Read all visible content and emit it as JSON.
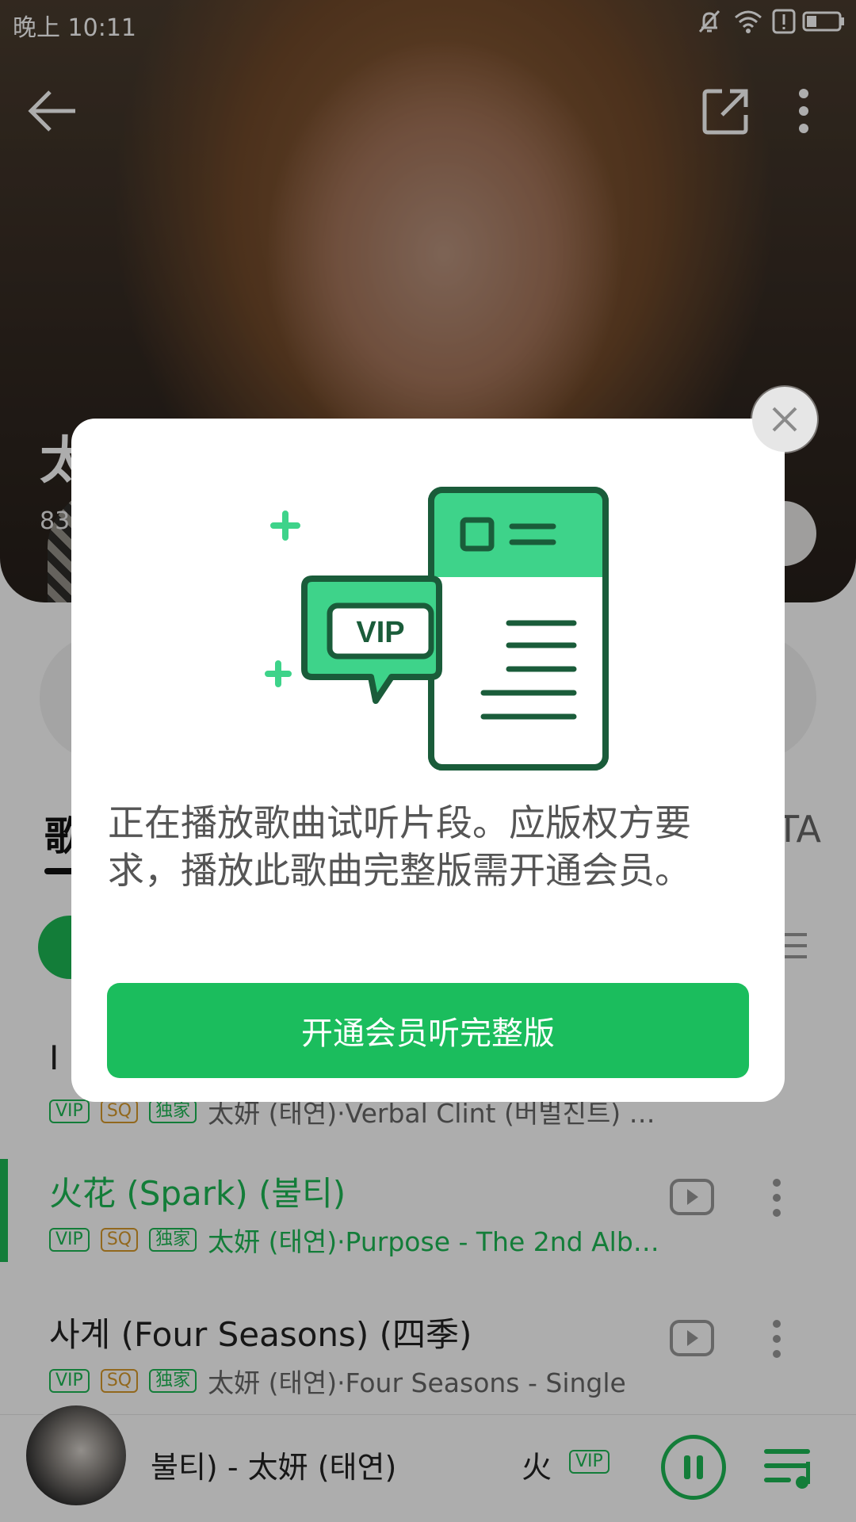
{
  "status_bar": {
    "time": "晚上 10:11",
    "icons": [
      "bell-off-icon",
      "wifi-icon",
      "alert-icon",
      "battery-icon"
    ]
  },
  "top_nav": {
    "back_icon": "back-arrow-icon",
    "share_icon": "share-icon",
    "more_icon": "more-vertical-icon"
  },
  "tabs": {
    "active_label": "歌",
    "right_label": "TA"
  },
  "songs": [
    {
      "title": "I (",
      "tags": [
        "VIP",
        "SQ",
        "独家"
      ],
      "artist": "太妍 (태연)·Verbal Clint (버벌진트) I…",
      "active": false
    },
    {
      "title": "火花 (Spark) (불티)",
      "tags": [
        "VIP",
        "SQ",
        "独家"
      ],
      "artist": "太妍 (태연)·Purpose - The 2nd Alb…",
      "active": true
    },
    {
      "title": "사계 (Four Seasons) (四季)",
      "tags": [
        "VIP",
        "SQ",
        "独家"
      ],
      "artist": "太妍 (태연)·Four Seasons - Single",
      "active": false
    }
  ],
  "mini_player": {
    "now_playing": "불티) - 太妍 (태연)",
    "scroll_text": "火",
    "badge": "VIP"
  },
  "dialog": {
    "illustration_badge": "VIP",
    "message": "正在播放歌曲试听片段。应版权方要求，播放此歌曲完整版需开通会员。",
    "cta_label": "开通会员听完整版",
    "close_icon": "close-icon"
  },
  "colors": {
    "brand_green": "#1bbd5d",
    "sq_orange": "#d89a2b"
  }
}
